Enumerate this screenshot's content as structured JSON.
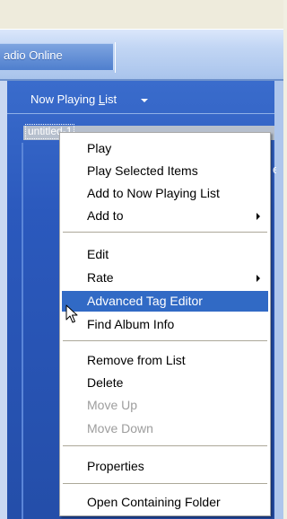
{
  "tabs": {
    "radio_label": "adio Online"
  },
  "list_header": {
    "label_prefix": "Now Playing ",
    "label_accel": "L",
    "label_suffix": "ist",
    "dropdown_icon": "triangle-down"
  },
  "playlist": {
    "label": "untitled-1",
    "behind_text": "e"
  },
  "context_menu": {
    "items": {
      "play": "Play",
      "play_selected": "Play Selected Items",
      "add_now_playing": "Add to Now Playing List",
      "add_to": "Add to",
      "edit": "Edit",
      "rate": "Rate",
      "advanced_tag_editor": "Advanced Tag Editor",
      "find_album_info": "Find Album Info",
      "remove_from_list": "Remove from List",
      "delete": "Delete",
      "move_up": "Move Up",
      "move_down": "Move Down",
      "properties": "Properties",
      "open_containing_folder": "Open Containing Folder"
    },
    "selected_item": "Advanced Tag Editor",
    "disabled_items": [
      "Move Up",
      "Move Down"
    ],
    "submenu_items": [
      "Add to",
      "Rate"
    ]
  },
  "colors": {
    "selection": "#316ac5",
    "panel_blue": "#2f5fc2",
    "disabled_text": "#9d9d9d"
  }
}
